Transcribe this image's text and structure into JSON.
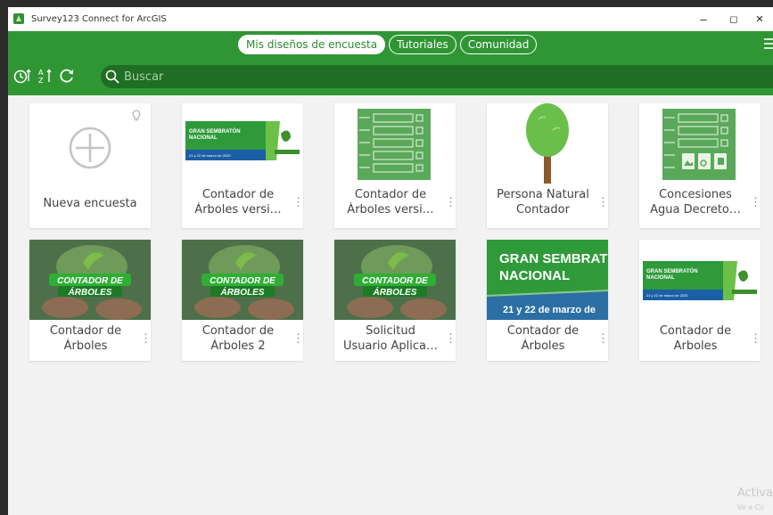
{
  "window": {
    "title": "Survey123 Connect for ArcGIS",
    "minimize": "–",
    "maximize": "◻",
    "close": "✕"
  },
  "tabs": [
    "Mis diseños de encuesta",
    "Tutoriales",
    "Comunidad"
  ],
  "toolbar": {
    "search_placeholder": "Buscar"
  },
  "new_survey": {
    "label": "Nueva encuesta"
  },
  "surveys": [
    {
      "line1": "Contador de",
      "line2": "Árboles versi…",
      "thumb": "gran-sembraton-banner"
    },
    {
      "line1": "Contador de",
      "line2": "Árboles versi…",
      "thumb": "form-icon"
    },
    {
      "line1": "Persona Natural",
      "line2": "Contador",
      "thumb": "tree-icon"
    },
    {
      "line1": "Concesiones",
      "line2": "Agua Decreto…",
      "thumb": "form-attachments-icon"
    },
    {
      "line1": "Contador de",
      "line2": "Árboles",
      "thumb": "contador-photo"
    },
    {
      "line1": "Contador de",
      "line2": "Árboles 2",
      "thumb": "contador-photo"
    },
    {
      "line1": "Solicitud",
      "line2": "Usuario Aplica…",
      "thumb": "contador-photo"
    },
    {
      "line1": "Contador de",
      "line2": "Árboles",
      "thumb": "gran-sembraton-large"
    },
    {
      "line1": "Contador de",
      "line2": "Arboles",
      "thumb": "gran-sembraton-banner"
    }
  ],
  "banner": {
    "small_title_1": "GRAN SEMBRATÓN",
    "small_title_2": "NACIONAL",
    "small_date": "21 y 22 de marzo de 2020",
    "large_title_1": "GRAN SEMBRAT",
    "large_title_2": "NACIONAL",
    "large_date": "21 y 22 de marzo de",
    "photo_title_1": "CONTADOR DE",
    "photo_title_2": "ÁRBOLES"
  },
  "watermark": {
    "line1": "Activa",
    "line2": "Ve a Co"
  },
  "colors": {
    "header_green": "#309634",
    "search_green": "#1f6e23",
    "card_bg": "#ffffff",
    "page_bg": "#f2f2f2"
  }
}
